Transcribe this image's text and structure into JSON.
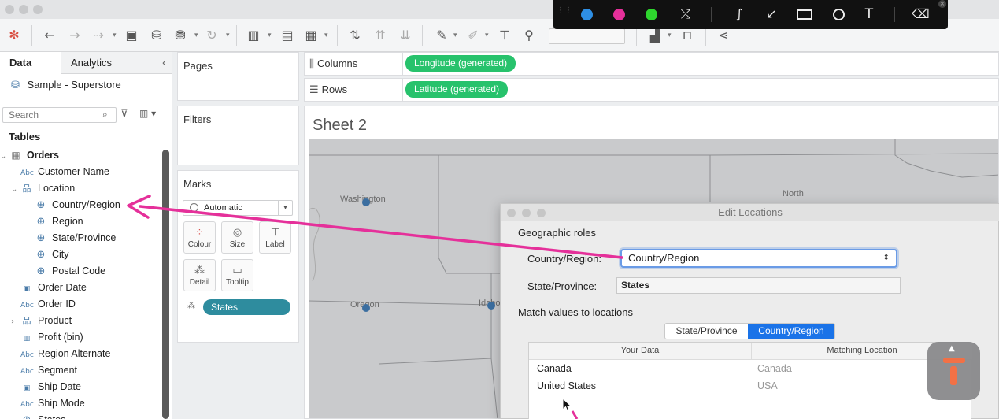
{
  "annotation_toolbar": {
    "colors": [
      "#2e8fe5",
      "#e5309a",
      "#2ed62e"
    ],
    "tools": [
      "shuffle-icon",
      "curve-icon",
      "arrow-icon",
      "rectangle-icon",
      "circle-icon",
      "text-icon",
      "eraser-icon"
    ],
    "text_tool_label": "T"
  },
  "toolbar": {
    "icons": [
      "tableau-logo-icon",
      "back-icon",
      "forward-icon",
      "link-icon",
      "save-icon",
      "new-datasource-icon",
      "datasource-icon",
      "refresh-icon",
      "new-sheet-icon",
      "duplicate-sheet-icon",
      "clear-sheet-icon",
      "swap-icon",
      "sort-asc-icon",
      "sort-desc-icon",
      "highlight-icon",
      "paperclip-icon",
      "text-label-icon",
      "pin-icon",
      "show-me-icon",
      "presentation-icon",
      "share-icon"
    ]
  },
  "data_pane": {
    "tabs": [
      "Data",
      "Analytics"
    ],
    "collapse_glyph": "‹",
    "datasource": "Sample - Superstore",
    "search_placeholder": "Search",
    "tables_heading": "Tables",
    "fields": [
      {
        "label": "Orders",
        "type": "table",
        "indent": 0,
        "expand": "⌄",
        "bold": true
      },
      {
        "label": "Customer Name",
        "type": "Abc",
        "indent": 1
      },
      {
        "label": "Location",
        "type": "hierarchy",
        "indent": 1,
        "expand": "⌄"
      },
      {
        "label": "Country/Region",
        "type": "geo",
        "indent": 2
      },
      {
        "label": "Region",
        "type": "geo",
        "indent": 2
      },
      {
        "label": "State/Province",
        "type": "geo",
        "indent": 2
      },
      {
        "label": "City",
        "type": "geo",
        "indent": 2
      },
      {
        "label": "Postal Code",
        "type": "geo",
        "indent": 2
      },
      {
        "label": "Order Date",
        "type": "date",
        "indent": 1
      },
      {
        "label": "Order ID",
        "type": "Abc",
        "indent": 1
      },
      {
        "label": "Product",
        "type": "hierarchy",
        "indent": 1,
        "expand": "›"
      },
      {
        "label": "Profit (bin)",
        "type": "bin",
        "indent": 1
      },
      {
        "label": "Region Alternate",
        "type": "Abc",
        "indent": 1
      },
      {
        "label": "Segment",
        "type": "Abc",
        "indent": 1
      },
      {
        "label": "Ship Date",
        "type": "date",
        "indent": 1
      },
      {
        "label": "Ship Mode",
        "type": "Abc",
        "indent": 1
      },
      {
        "label": "States",
        "type": "geo",
        "indent": 1
      }
    ]
  },
  "shelves": {
    "pages": "Pages",
    "filters": "Filters",
    "marks": "Marks",
    "marks_type": "Automatic",
    "mark_buttons": [
      "Colour",
      "Size",
      "Label",
      "Detail",
      "Tooltip"
    ],
    "states_pill": "States",
    "columns_label": "Columns",
    "rows_label": "Rows",
    "columns_pill": "Longitude (generated)",
    "rows_pill": "Latitude (generated)"
  },
  "sheet": {
    "title": "Sheet 2",
    "map_labels": [
      "Washington",
      "Oregon",
      "Idaho",
      "North"
    ]
  },
  "dialog": {
    "title": "Edit Locations",
    "geographic_roles": "Geographic roles",
    "country_label": "Country/Region:",
    "country_value": "Country/Region",
    "state_label": "State/Province:",
    "state_value": "States",
    "match_heading": "Match values to locations",
    "segments": [
      "State/Province",
      "Country/Region"
    ],
    "selected_segment": "Country/Region",
    "columns": [
      "Your Data",
      "Matching Location"
    ],
    "rows": [
      {
        "your_data": "Canada",
        "matching": "Canada"
      },
      {
        "your_data": "United States",
        "matching": "USA"
      }
    ]
  },
  "colors": {
    "pill_green": "#27c26c",
    "pill_teal": "#2e8c9e",
    "arrow_magenta": "#e5309a",
    "selected_blue": "#1a73e8",
    "badge_orange": "#f26a3d"
  }
}
